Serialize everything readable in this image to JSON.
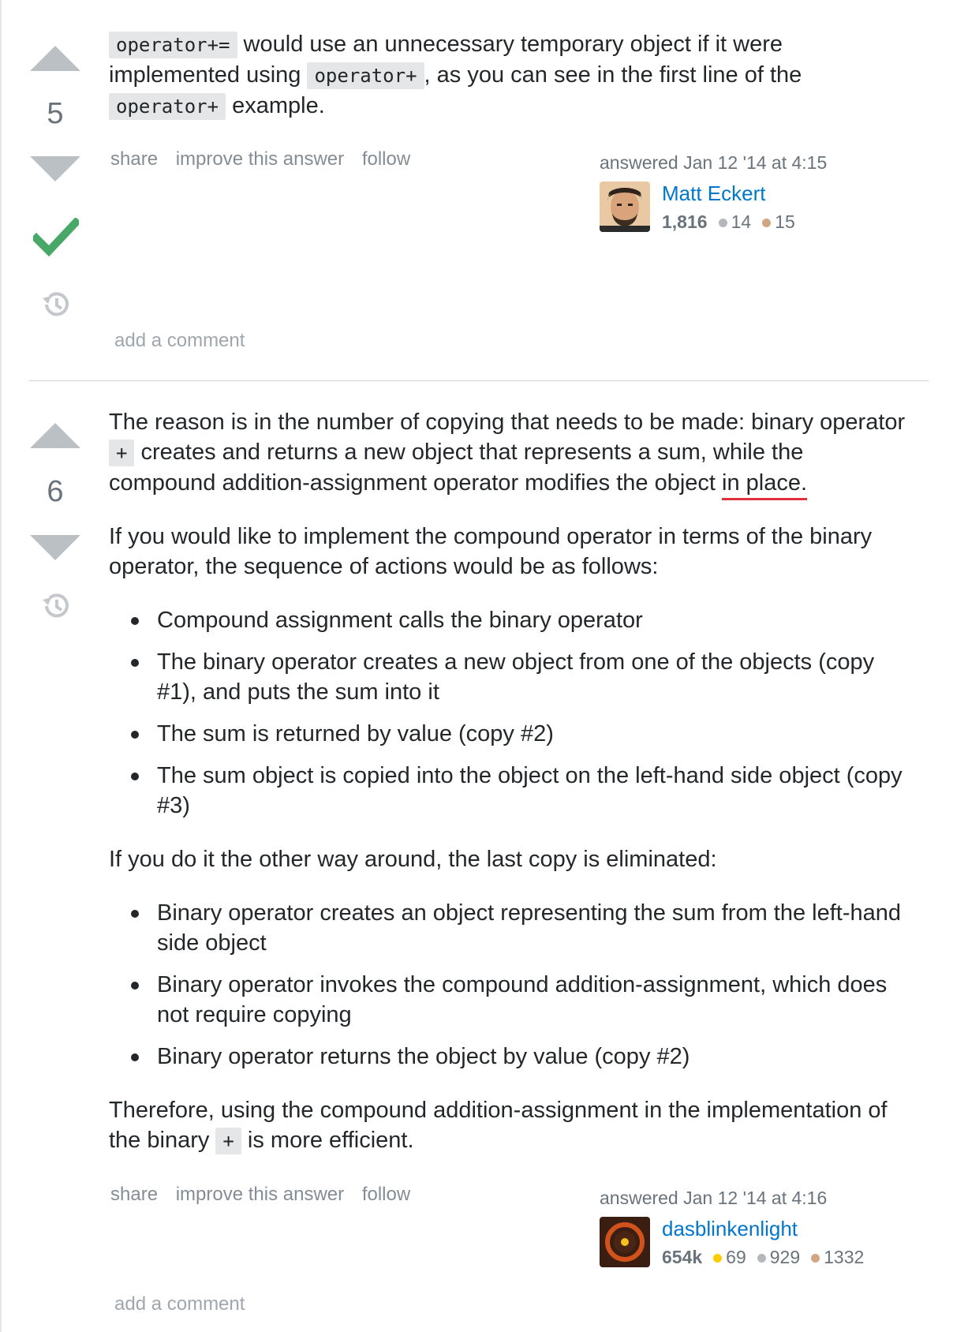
{
  "answers": [
    {
      "vote_count": "5",
      "accepted": true,
      "paragraphs": [
        {
          "code1": "operator+=",
          "text1": " would use an unnecessary temporary object if it were implemented using ",
          "code2": "operator+",
          "text2": ", as you can see in the first line of the ",
          "code3": "operator+",
          "text3": " example."
        }
      ],
      "menu": {
        "share": "share",
        "improve": "improve this answer",
        "follow": "follow"
      },
      "signature": {
        "action_time": "answered Jan 12 '14 at 4:15",
        "user_name": "Matt Eckert",
        "reputation": "1,816",
        "silver": "14",
        "bronze": "15"
      },
      "add_comment": "add a comment"
    },
    {
      "vote_count": "6",
      "accepted": false,
      "p1": {
        "text1": "The reason is in the number of copying that needs to be made: binary operator ",
        "code1": "+",
        "text2": " creates and returns a new object that represents a sum, while the compound addition-assignment operator modifies the object ",
        "underlined": "in place."
      },
      "p2": "If you would like to implement the compound operator in terms of the binary operator, the sequence of actions would be as follows:",
      "list1": [
        "Compound assignment calls the binary operator",
        "The binary operator creates a new object from one of the objects (copy #1), and puts the sum into it",
        "The sum is returned by value (copy #2)",
        "The sum object is copied into the object on the left-hand side object (copy #3)"
      ],
      "p3": "If you do it the other way around, the last copy is eliminated:",
      "list2": [
        "Binary operator creates an object representing the sum from the left-hand side object",
        "Binary operator invokes the compound addition-assignment, which does not require copying",
        "Binary operator returns the object by value (copy #2)"
      ],
      "p4": {
        "text1": "Therefore, using the compound addition-assignment in the implementation of the binary ",
        "code1": "+",
        "text2": " is more efficient."
      },
      "menu": {
        "share": "share",
        "improve": "improve this answer",
        "follow": "follow"
      },
      "signature": {
        "action_time": "answered Jan 12 '14 at 4:16",
        "user_name": "dasblinkenlight",
        "reputation": "654k",
        "gold": "69",
        "silver": "929",
        "bronze": "1332"
      },
      "add_comment": "add a comment"
    }
  ],
  "colors": {
    "vote_arrow": "#bbc0c4",
    "accepted": "#48a868",
    "link": "#0077cc",
    "underline": "#e0303c"
  },
  "icons": [
    "vote-up-icon",
    "vote-down-icon",
    "accepted-check-icon",
    "history-icon"
  ]
}
